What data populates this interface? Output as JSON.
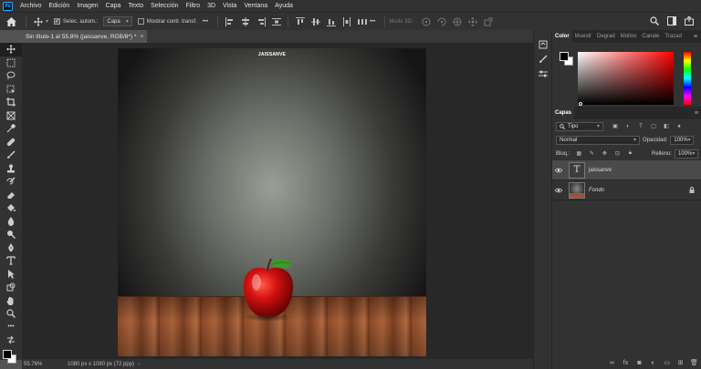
{
  "app": {
    "logo": "Ps"
  },
  "menu": [
    "Archivo",
    "Edición",
    "Imagen",
    "Capa",
    "Texto",
    "Selección",
    "Filtro",
    "3D",
    "Vista",
    "Ventana",
    "Ayuda"
  ],
  "options": {
    "auto_select_label": "Selec. autom.:",
    "auto_select_value": "Capa",
    "transform_label": "Mostrar contr. transf.",
    "mode3d_label": "Modo 3D:"
  },
  "document": {
    "tab_title": "Sin título-1 al 55.8% (jaissanve, RGB/8*) *",
    "close": "×",
    "canvas_text": "JAISSANVE"
  },
  "status": {
    "zoom": "55.76%",
    "info": "1080 px x 1080 px (72 ppp)",
    "arrow": "›"
  },
  "color_panel": {
    "tabs": [
      "Color",
      "Muestr",
      "Degrad",
      "Motivo",
      "Canale",
      "Trazad"
    ],
    "foreground": "#000000",
    "background": "#ffffff",
    "hue": "#ff0000"
  },
  "layers_panel": {
    "tab": "Capas",
    "filter": "Tipo",
    "blend_mode": "Normal",
    "opacity_label": "Opacidad:",
    "opacity_value": "100%",
    "lock_label": "Bloq.:",
    "fill_label": "Relleno:",
    "fill_value": "100%",
    "layers": [
      {
        "name": "jaissanve",
        "type": "text",
        "thumb": "T",
        "selected": true
      },
      {
        "name": "Fondo",
        "type": "image",
        "selected": false,
        "locked": true
      }
    ]
  }
}
